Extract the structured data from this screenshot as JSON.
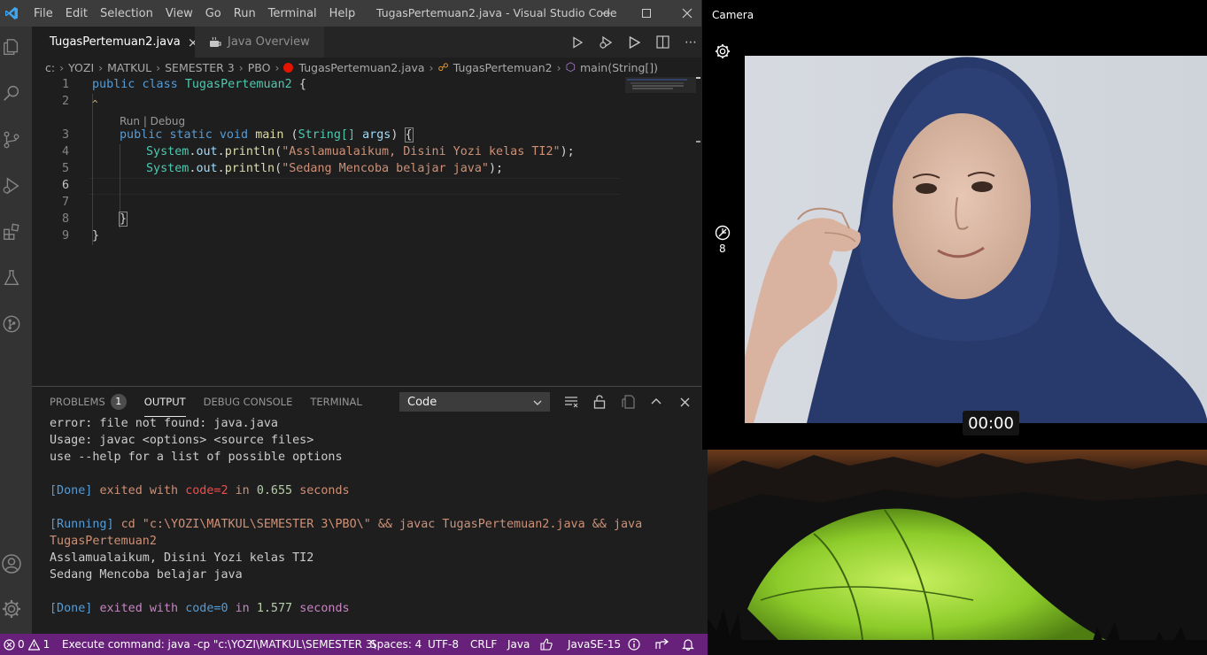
{
  "titlebar": {
    "menu": [
      "File",
      "Edit",
      "Selection",
      "View",
      "Go",
      "Run",
      "Terminal",
      "Help"
    ],
    "window_title": "TugasPertemuan2.java - Visual Studio Code"
  },
  "tabs": [
    {
      "label": "TugasPertemuan2.java",
      "close": "×"
    },
    {
      "label": "Java Overview"
    }
  ],
  "breadcrumb": [
    "c:",
    "YOZI",
    "MATKUL",
    "SEMESTER 3",
    "PBO",
    "TugasPertemuan2.java",
    "TugasPertemuan2",
    "main(String[])"
  ],
  "editor": {
    "line_numbers": [
      "1",
      "2",
      "3",
      "4",
      "5",
      "6",
      "7",
      "8",
      "9"
    ],
    "codelens": "Run | Debug",
    "lines": {
      "l1_kw1": "public",
      "l1_kw2": "class",
      "l1_cls": "TugasPertemuan2",
      "l1_brace": "{",
      "l3_kw1": "public",
      "l3_kw2": "static",
      "l3_kw3": "void",
      "l3_fn": "main",
      "l3_open": "(",
      "l3_type": "String[]",
      "l3_arg": "args",
      "l3_close": ")",
      "l3_brace": "{",
      "l4_sys": "System",
      "l4_out": "out",
      "l4_fn": "println",
      "l4_str": "\"Asslamualaikum, Disini Yozi kelas TI2\"",
      "l5_sys": "System",
      "l5_out": "out",
      "l5_fn": "println",
      "l5_str": "\"Sedang Mencoba belajar java\"",
      "l8_brace": "}",
      "l9_brace": "}"
    }
  },
  "panel": {
    "tabs": [
      "PROBLEMS",
      "OUTPUT",
      "DEBUG CONSOLE",
      "TERMINAL"
    ],
    "problems_count": "1",
    "output_channel": "Code",
    "output": {
      "o1": "error: file not found: java.java",
      "o2": "Usage: javac <options> <source files>",
      "o3": "use --help for a list of possible options",
      "o4_done": "[Done]",
      "o4_exited": "exited with",
      "o4_code": "code=2",
      "o4_in": "in",
      "o4_secs": "0.655",
      "o4_seconds": "seconds",
      "o5_running": "[Running]",
      "o5_cmd": "cd \"c:\\YOZI\\MATKUL\\SEMESTER 3\\PBO\\\" && javac TugasPertemuan2.java && java",
      "o5_cmd2": "TugasPertemuan2",
      "o6": "Asslamualaikum, Disini Yozi kelas TI2",
      "o7": "Sedang Mencoba belajar java",
      "o8_done": "[Done]",
      "o8_exited": "exited with",
      "o8_code": "code=0",
      "o8_in": "in",
      "o8_secs": "1.577",
      "o8_seconds": "seconds"
    }
  },
  "statusbar": {
    "errors": "0",
    "warnings": "1",
    "command": "Execute command: java -cp \"c:\\YOZI\\MATKUL\\SEMESTER 3\\",
    "spaces": "Spaces: 4",
    "encoding": "UTF-8",
    "eol": "CRLF",
    "language": "Java",
    "runtime": "JavaSE-15"
  },
  "camera": {
    "title": "Camera",
    "counter": "8",
    "timer": "00:00"
  },
  "colors": {
    "statusbar": "#68217a",
    "titlebar": "#3c3c3c",
    "activitybar": "#333333",
    "editor_bg": "#1e1e1e"
  }
}
